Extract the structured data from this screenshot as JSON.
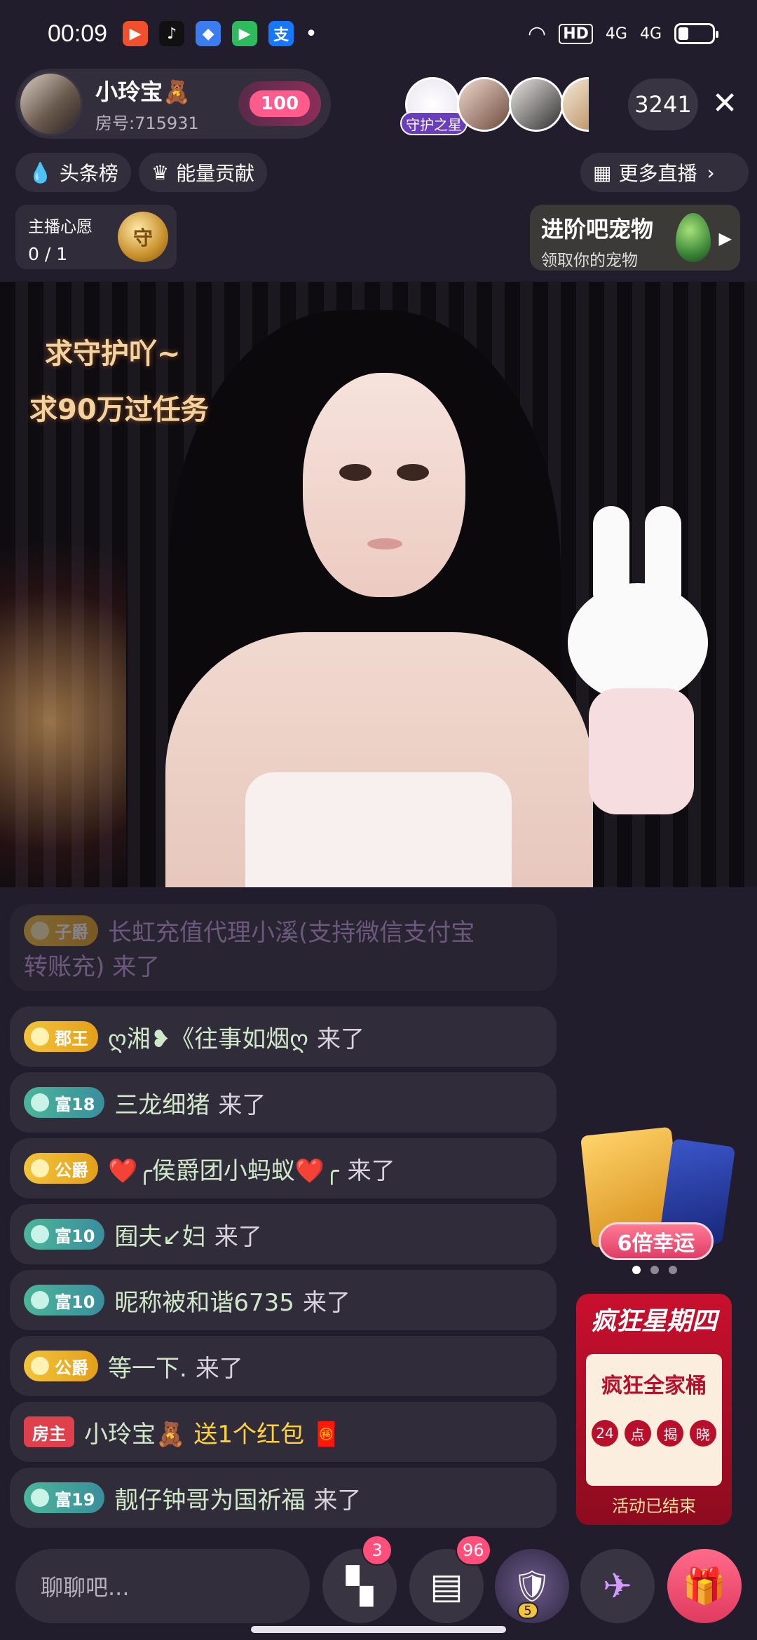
{
  "status": {
    "time": "00:09",
    "hd": "HD",
    "net1": "4G",
    "net2": "4G"
  },
  "host": {
    "name": "小玲宝🧸",
    "room_id": "房号:715931",
    "heat": "100"
  },
  "viewers": {
    "guard_label": "守护之星",
    "count": "3241"
  },
  "nav": {
    "headline_label": "头条榜",
    "energy_label": "能量贡献",
    "more_live_label": "更多直播"
  },
  "wish": {
    "title": "主播心愿",
    "progress": "0 / 1",
    "medal": "守"
  },
  "pet": {
    "title": "进阶吧宠物",
    "subtitle": "领取你的宠物"
  },
  "video": {
    "line1": "求守护吖~",
    "line2": "求90万过任务"
  },
  "chat": [
    {
      "badge": "子爵",
      "badge_type": "gold",
      "name": "长虹充值代理小溪(支持微信支付宝",
      "tail": "转账充) 来了",
      "faded": true
    },
    {
      "badge": "郡王",
      "badge_type": "gold",
      "name": "ღ湘❥《往事如烟ღ",
      "tail": "来了"
    },
    {
      "badge": "富18",
      "badge_type": "green",
      "name": "三龙细猪",
      "tail": "来了"
    },
    {
      "badge": "公爵",
      "badge_type": "gold",
      "name": "❤️╭侯爵团小蚂蚁❤️╭",
      "tail": "来了"
    },
    {
      "badge": "富10",
      "badge_type": "green",
      "name": "囿夫↙妇",
      "tail": "来了"
    },
    {
      "badge": "富10",
      "badge_type": "green",
      "name": "昵称被和谐6735",
      "tail": "来了"
    },
    {
      "badge": "公爵",
      "badge_type": "gold",
      "name": "等一下.",
      "tail": "来了"
    },
    {
      "badge": "房主",
      "badge_type": "host",
      "name": "小玲宝🧸",
      "tail": "送1个红包 🧧"
    },
    {
      "badge": "富19",
      "badge_type": "green",
      "name": "靓仔钟哥为国祈福",
      "tail": "来了"
    }
  ],
  "promo": {
    "lucky_label": "6倍幸运",
    "kfc_title": "疯狂星期四",
    "kfc_main": "疯狂全家桶",
    "kfc_chips": [
      "24",
      "点",
      "揭",
      "晓"
    ],
    "kfc_status": "活动已结束"
  },
  "bottom": {
    "input_placeholder": "聊聊吧...",
    "apps_badge": "3",
    "msg_badge": "96",
    "guard_level": "5"
  }
}
